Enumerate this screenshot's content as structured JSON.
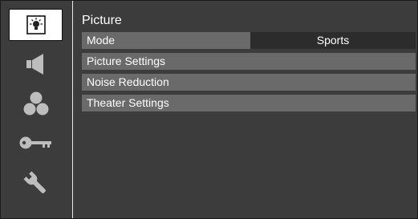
{
  "sidebar": {
    "items": [
      {
        "name": "picture",
        "icon": "lightbulb-icon",
        "active": true
      },
      {
        "name": "sound",
        "icon": "speaker-icon",
        "active": false
      },
      {
        "name": "channels",
        "icon": "three-circles-icon",
        "active": false
      },
      {
        "name": "lock",
        "icon": "key-icon",
        "active": false
      },
      {
        "name": "setup",
        "icon": "wrench-icon",
        "active": false
      }
    ]
  },
  "menu": {
    "title": "Picture",
    "items": [
      {
        "label": "Mode",
        "value": "Sports"
      },
      {
        "label": "Picture Settings"
      },
      {
        "label": "Noise Reduction"
      },
      {
        "label": "Theater Settings"
      }
    ]
  },
  "colors": {
    "background": "#3c3c3c",
    "row": "#6a6a6a",
    "value_cell": "#2c2c2c",
    "text": "#ffffff"
  }
}
